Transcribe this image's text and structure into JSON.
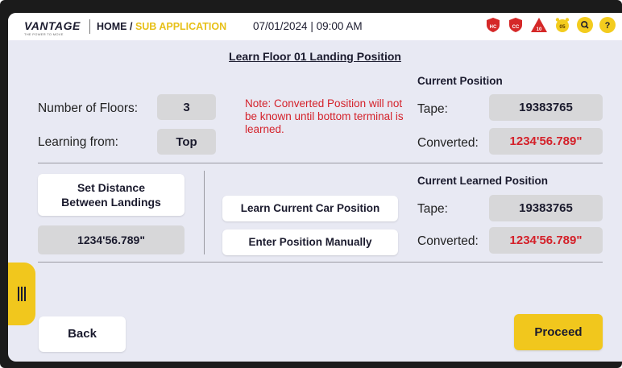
{
  "header": {
    "logo": "VANTAGE",
    "logo_tagline": "THE POWER TO MOVE",
    "breadcrumb_home": "HOME /",
    "breadcrumb_sub": "SUB APPLICATION",
    "datetime": "07/01/2024 | 09:00 AM",
    "icons": [
      {
        "name": "hc-shield-icon",
        "label": "HC",
        "color": "#d52828"
      },
      {
        "name": "cc-shield-icon",
        "label": "CC",
        "color": "#d52828"
      },
      {
        "name": "alert-triangle-icon",
        "label": "10",
        "color": "#d52828"
      },
      {
        "name": "alarm-clock-icon",
        "label": "05",
        "color": "#f3cc1e"
      },
      {
        "name": "search-icon",
        "label": "Q",
        "color": "#f3cc1e"
      },
      {
        "name": "help-icon",
        "label": "?",
        "color": "#f3cc1e"
      }
    ]
  },
  "page": {
    "title": "Learn Floor 01 Landing Position"
  },
  "settings": {
    "floors_label": "Number of Floors:",
    "floors_value": "3",
    "learning_label": "Learning from:",
    "learning_value": "Top"
  },
  "note": "Note: Converted Position will not be known until bottom terminal is learned.",
  "current_position": {
    "header": "Current Position",
    "tape_label": "Tape:",
    "tape_value": "19383765",
    "converted_label": "Converted:",
    "converted_value": "1234'56.789\""
  },
  "learned_position": {
    "header": "Current Learned Position",
    "tape_label": "Tape:",
    "tape_value": "19383765",
    "converted_label": "Converted:",
    "converted_value": "1234'56.789\""
  },
  "distance": {
    "button_line1": "Set Distance",
    "button_line2": "Between Landings",
    "value": "1234'56.789\""
  },
  "actions": {
    "learn_car_position": "Learn Current Car Position",
    "enter_manually": "Enter Position Manually",
    "back": "Back",
    "proceed": "Proceed"
  },
  "colors": {
    "accent": "#f1c71d",
    "alert_red": "#d4212a",
    "background": "#e8e9f3"
  }
}
